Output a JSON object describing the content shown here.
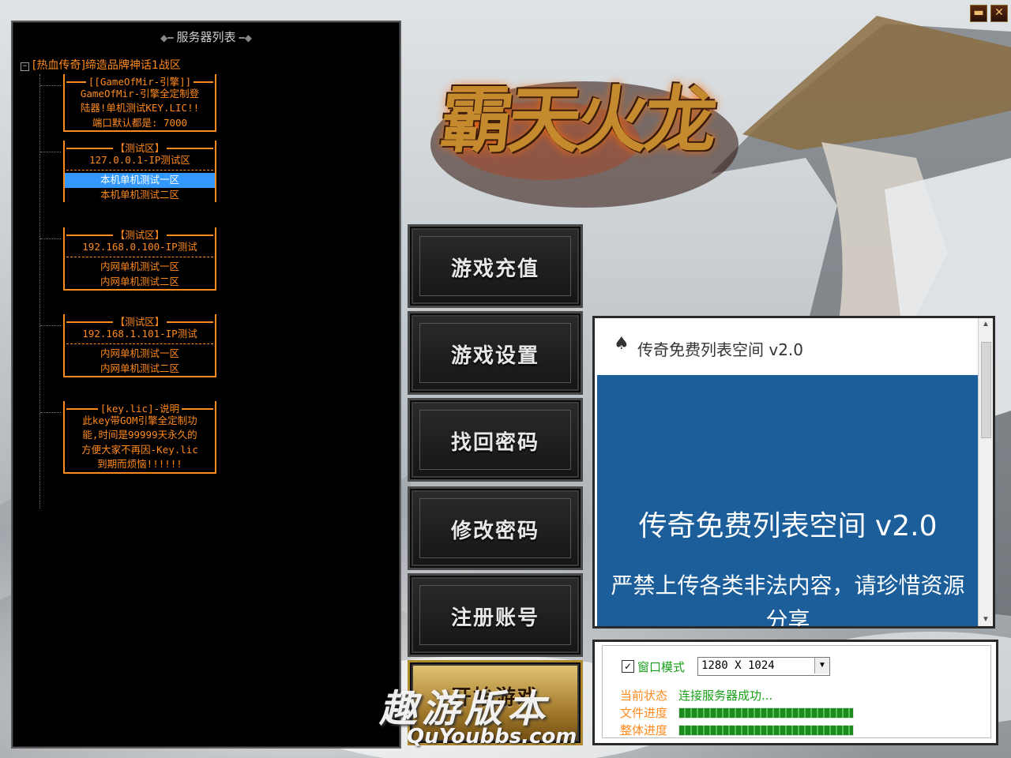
{
  "window": {
    "min_label": "▬",
    "close_label": "✕"
  },
  "server_panel": {
    "title": "服务器列表",
    "root": "[热血传奇]缔造品牌神话1战区",
    "blocks": [
      {
        "header": "[[GameOfMir-引擎]]",
        "lines": [
          "GameOfMir-引擎全定制登",
          "陆器!单机测试KEY.LIC!!",
          "端口默认都是: 7000"
        ]
      },
      {
        "header": "【测试区】",
        "lines": [
          "127.0.0.1-IP测试区"
        ],
        "servers": [
          "本机单机测试一区",
          "本机单机测试二区"
        ]
      },
      {
        "header": "【测试区】",
        "lines": [
          "192.168.0.100-IP测试"
        ],
        "servers": [
          "内网单机测试一区",
          "内网单机测试二区"
        ]
      },
      {
        "header": "【测试区】",
        "lines": [
          "192.168.1.101-IP测试"
        ],
        "servers": [
          "内网单机测试一区",
          "内网单机测试二区"
        ]
      },
      {
        "header": "[key.lic]-说明",
        "lines": [
          "此key带GOM引擎全定制功",
          "能,时间是99999天永久的",
          "方便大家不再因-Key.lic",
          "到期而烦恼!!!!!!"
        ]
      }
    ],
    "selected_server": "本机单机测试一区"
  },
  "logo": {
    "text": "霸天火龙"
  },
  "menu": {
    "recharge": "游戏充值",
    "settings": "游戏设置",
    "recover": "找回密码",
    "change_pw": "修改密码",
    "register": "注册账号",
    "start": "开始游戏"
  },
  "browser": {
    "title": "传奇免费列表空间 v2.0",
    "heading": "传奇免费列表空间 v2.0",
    "message": "严禁上传各类非法内容，请珍惜资源分享"
  },
  "status": {
    "window_mode_label": "窗口模式",
    "window_mode_checked": true,
    "resolution": "1280 X 1024",
    "current_status_label": "当前状态",
    "current_status_value": "连接服务器成功...",
    "file_progress_label": "文件进度",
    "total_progress_label": "整体进度",
    "file_progress": 1.0,
    "total_progress": 1.0
  },
  "watermark": {
    "cn": "趣游版本",
    "en": "QuYoubbs.com"
  },
  "colors": {
    "tree_text": "#ff8a1e",
    "selection": "#3399ff",
    "status_green": "#18a018",
    "browser_blue": "#1b5e9a"
  }
}
